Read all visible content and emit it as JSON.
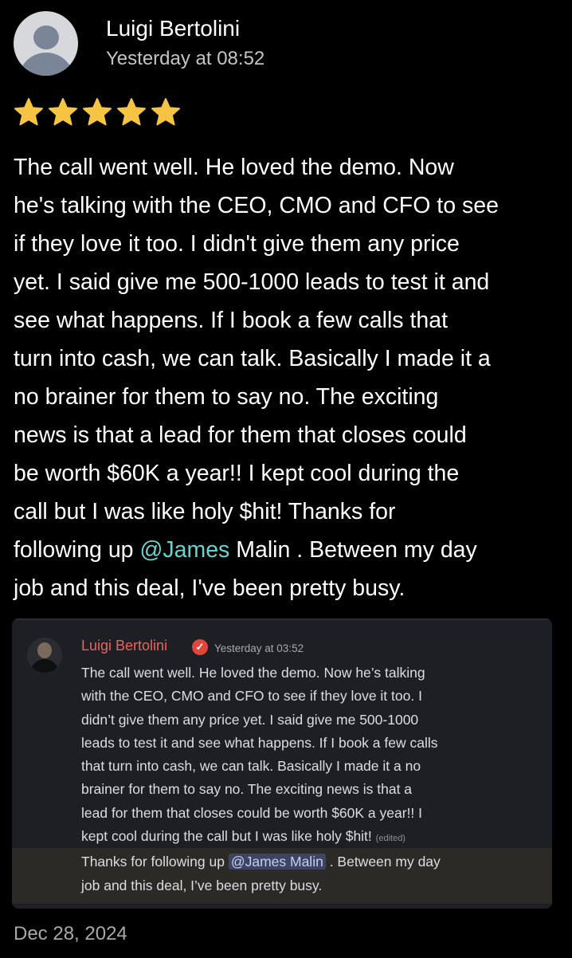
{
  "review": {
    "author": "Luigi Bertolini",
    "timestamp": "Yesterday at 08:52",
    "rating": 5,
    "rating_max": 5,
    "lines": [
      "The call went well. He loved the demo. Now",
      "he's talking with the CEO, CMO and CFO to see",
      "if they love it too. I didn't give them any price",
      "yet. I said give me 500-1000 leads to test it and",
      "see what happens. If I book a few calls that",
      "turn into cash, we can talk. Basically I made it a",
      "no brainer for them to say no. The exciting",
      "news is that a lead for them that closes could",
      "be worth $60K a year!! I kept cool during the",
      "call but I was like holy $hit! Thanks for"
    ],
    "line11_before": "following up ",
    "line11_mention": "@James",
    "line11_after": " Malin . Between my day",
    "line12": "job and this deal, I've been pretty busy.",
    "date": "Dec 28, 2024"
  },
  "embed": {
    "author": "Luigi Bertolini",
    "timestamp": "Yesterday at 03:52",
    "lines": [
      "The call went well. He loved the demo. Now he’s talking",
      "with the CEO, CMO and CFO to see if they love it too. I",
      "didn’t give them any price yet. I said give me 500-1000",
      "leads to test it and see what happens. If I book a few calls",
      "that turn into cash, we can talk. Basically I made it a no",
      "brainer for them to say no. The exciting news is that a",
      "lead for them that closes could be worth $60K a year!! I"
    ],
    "line8": "kept cool during the call but I was like holy $hit!",
    "edited": "(edited)",
    "line9_before": "Thanks for following up ",
    "line9_mention": "@James Malin",
    "line9_after": " . Between my day",
    "line10": "job and this deal, I’ve been pretty busy."
  },
  "colors": {
    "background": "#000000",
    "star": "#f6c443",
    "mention": "#69d3cf",
    "embed_name": "#e8655d",
    "embed_bg": "#1e1f25"
  },
  "icons": {
    "star": "star-icon",
    "verified": "verified-badge-icon"
  }
}
